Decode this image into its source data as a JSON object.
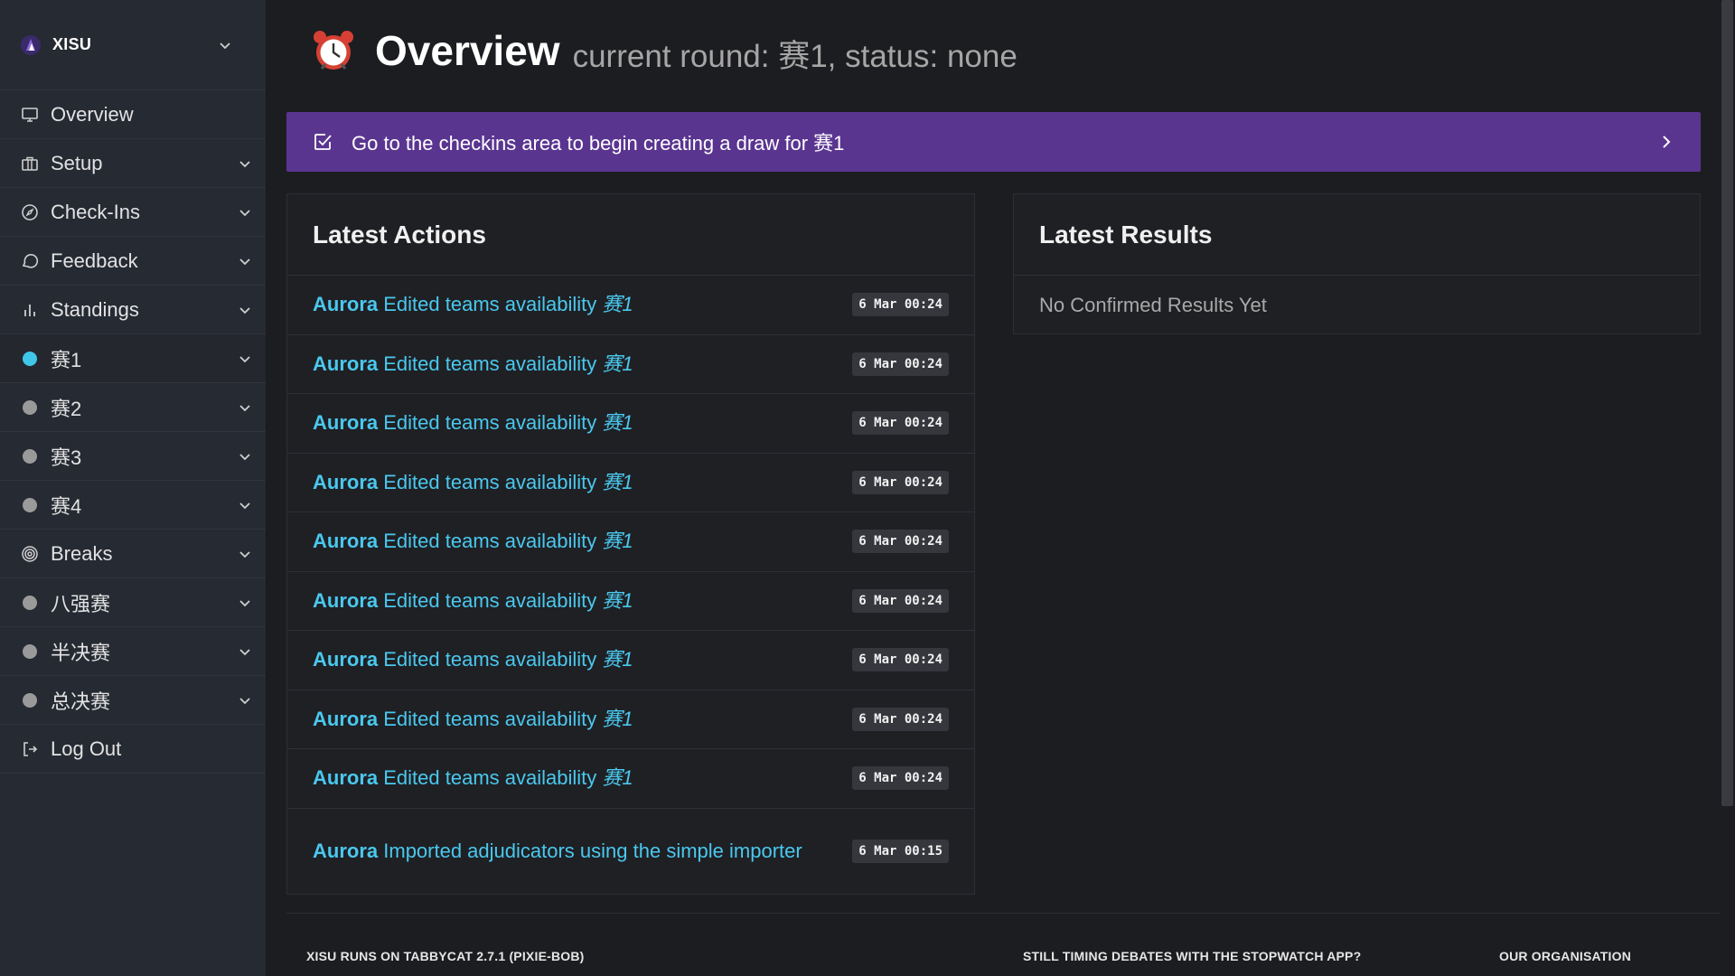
{
  "brand": {
    "name": "XISU"
  },
  "nav": [
    {
      "key": "overview",
      "label": "Overview",
      "icon": "monitor-icon",
      "chevron": false
    },
    {
      "key": "setup",
      "label": "Setup",
      "icon": "briefcase-icon",
      "chevron": true
    },
    {
      "key": "checkins",
      "label": "Check-Ins",
      "icon": "compass-icon",
      "chevron": true
    },
    {
      "key": "feedback",
      "label": "Feedback",
      "icon": "message-circle-icon",
      "chevron": true
    },
    {
      "key": "standings",
      "label": "Standings",
      "icon": "bar-chart-icon",
      "chevron": true
    },
    {
      "key": "round1",
      "label": "赛1",
      "icon": "status-dot-icon",
      "dot": "#3fc6e8",
      "chevron": true,
      "active": true
    },
    {
      "key": "round2",
      "label": "赛2",
      "icon": "status-dot-icon",
      "dot": "#9a9a9a",
      "chevron": true
    },
    {
      "key": "round3",
      "label": "赛3",
      "icon": "status-dot-icon",
      "dot": "#9a9a9a",
      "chevron": true
    },
    {
      "key": "round4",
      "label": "赛4",
      "icon": "status-dot-icon",
      "dot": "#9a9a9a",
      "chevron": true
    },
    {
      "key": "breaks",
      "label": "Breaks",
      "icon": "target-icon",
      "chevron": true
    },
    {
      "key": "quarterfinal",
      "label": "八强赛",
      "icon": "status-dot-icon",
      "dot": "#9a9a9a",
      "chevron": true
    },
    {
      "key": "semifinal",
      "label": "半决赛",
      "icon": "status-dot-icon",
      "dot": "#9a9a9a",
      "chevron": true
    },
    {
      "key": "final",
      "label": "总决赛",
      "icon": "status-dot-icon",
      "dot": "#9a9a9a",
      "chevron": true
    },
    {
      "key": "logout",
      "label": "Log Out",
      "icon": "log-out-icon",
      "chevron": false
    }
  ],
  "header": {
    "title": "Overview",
    "subtitle": "current round: 赛1, status: none"
  },
  "banner": {
    "text": "Go to the checkins area to begin creating a draw for 赛1"
  },
  "latest_actions": {
    "title": "Latest Actions",
    "items": [
      {
        "user": "Aurora",
        "action": "Edited teams availability",
        "round": "赛1",
        "time": "6 Mar 00:24"
      },
      {
        "user": "Aurora",
        "action": "Edited teams availability",
        "round": "赛1",
        "time": "6 Mar 00:24"
      },
      {
        "user": "Aurora",
        "action": "Edited teams availability",
        "round": "赛1",
        "time": "6 Mar 00:24"
      },
      {
        "user": "Aurora",
        "action": "Edited teams availability",
        "round": "赛1",
        "time": "6 Mar 00:24"
      },
      {
        "user": "Aurora",
        "action": "Edited teams availability",
        "round": "赛1",
        "time": "6 Mar 00:24"
      },
      {
        "user": "Aurora",
        "action": "Edited teams availability",
        "round": "赛1",
        "time": "6 Mar 00:24"
      },
      {
        "user": "Aurora",
        "action": "Edited teams availability",
        "round": "赛1",
        "time": "6 Mar 00:24"
      },
      {
        "user": "Aurora",
        "action": "Edited teams availability",
        "round": "赛1",
        "time": "6 Mar 00:24"
      },
      {
        "user": "Aurora",
        "action": "Edited teams availability",
        "round": "赛1",
        "time": "6 Mar 00:24"
      },
      {
        "user": "Aurora",
        "action": "Imported adjudicators using the simple importer",
        "round": "",
        "time": "6 Mar 00:15"
      }
    ]
  },
  "latest_results": {
    "title": "Latest Results",
    "empty_text": "No Confirmed Results Yet"
  },
  "footer": {
    "left": "XISU RUNS ON TABBYCAT 2.7.1 (PIXIE-BOB)",
    "middle": "STILL TIMING DEBATES WITH THE STOPWATCH APP?",
    "right": "OUR ORGANISATION"
  },
  "colors": {
    "accent_purple": "#5a3590",
    "link_cyan": "#4ac8ee",
    "sidebar_bg": "#262a33",
    "page_bg": "#1c1d20"
  }
}
